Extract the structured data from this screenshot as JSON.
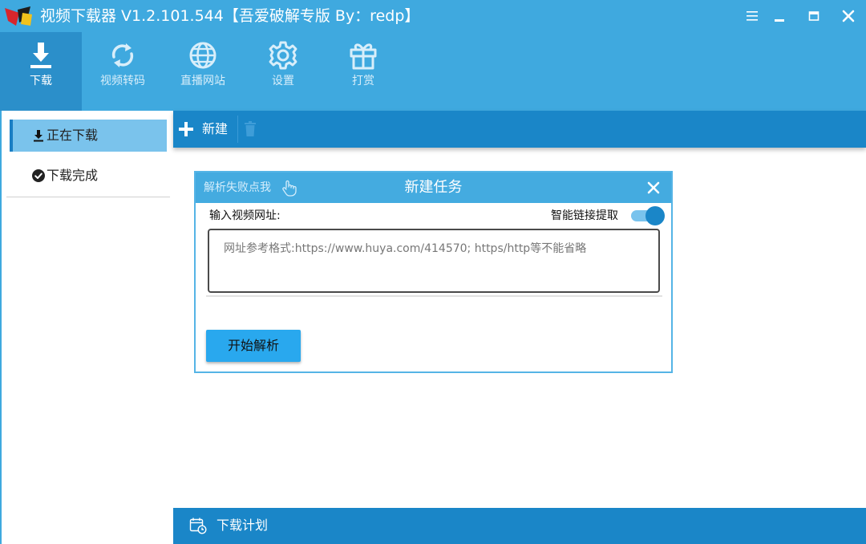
{
  "window": {
    "title": "视频下载器 V1.2.101.544【吾爱破解专版  By：redp】"
  },
  "toolbar": {
    "items": [
      {
        "label": "下载",
        "icon": "download-icon",
        "active": true
      },
      {
        "label": "视频转码",
        "icon": "convert-icon",
        "active": false
      },
      {
        "label": "直播网站",
        "icon": "globe-icon",
        "active": false
      },
      {
        "label": "设置",
        "icon": "gear-icon",
        "active": false
      },
      {
        "label": "打赏",
        "icon": "gift-icon",
        "active": false
      }
    ]
  },
  "sidebar": {
    "items": [
      {
        "label": "正在下载",
        "icon": "download-arrow-icon",
        "active": true
      },
      {
        "label": "下载完成",
        "icon": "check-circle-icon",
        "active": false
      }
    ]
  },
  "actionbar": {
    "new_label": "新建"
  },
  "dialog": {
    "help_text": "解析失败点我",
    "title": "新建任务",
    "url_label": "输入视频网址:",
    "smart_label": "智能链接提取",
    "smart_enabled": true,
    "url_value": "",
    "url_placeholder": "网址参考格式:https://www.huya.com/414570; https/http等不能省略",
    "parse_label": "开始解析"
  },
  "bottombar": {
    "schedule_label": "下载计划"
  },
  "colors": {
    "titlebar": "#3fa9df",
    "accent": "#1a86c8",
    "toolbar_active": "#2b8fca",
    "parse_button": "#29a8ee"
  }
}
